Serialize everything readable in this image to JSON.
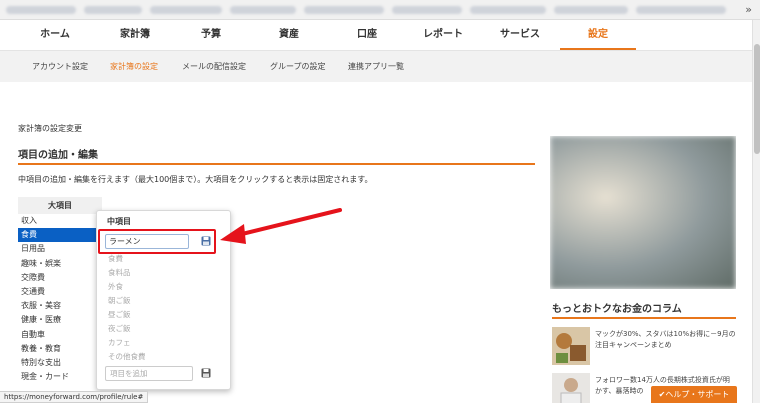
{
  "browser": {
    "more_label": "»",
    "status_url": "https://moneyforward.com/profile/rule#"
  },
  "main_nav": [
    "ホーム",
    "家計簿",
    "予算",
    "資産",
    "口座",
    "レポート",
    "サービス",
    "設定"
  ],
  "main_nav_active": "設定",
  "sub_nav": [
    "アカウント設定",
    "家計簿の設定",
    "メールの配信設定",
    "グループの設定",
    "連携アプリ一覧"
  ],
  "sub_nav_active": "家計簿の設定",
  "breadcrumb": "家計簿の設定変更",
  "section_title": "項目の追加・編集",
  "description": "中項目の追加・編集を行えます（最大100個まで）。大項目をクリックすると表示は固定されます。",
  "categories": {
    "header": "大項目",
    "items": [
      "収入",
      "食費",
      "日用品",
      "趣味・娯楽",
      "交際費",
      "交通費",
      "衣服・美容",
      "健康・医療",
      "自動車",
      "教養・教育",
      "特別な支出",
      "現金・カード"
    ],
    "selected": "食費"
  },
  "subcategory_popup": {
    "title": "中項目",
    "edit_value": "ラーメン",
    "items": [
      "食費",
      "食料品",
      "外食",
      "朝ご飯",
      "昼ご飯",
      "夜ご飯",
      "カフェ",
      "その他食費"
    ],
    "add_placeholder": "項目を追加",
    "save_icon": "floppy-disk-icon"
  },
  "sidebar": {
    "column_title": "もっとおトクなお金のコラム",
    "articles": [
      {
        "text": "マックが30%、スタバは10%お得に－9月の注目キャンペーンまとめ"
      },
      {
        "text": "フォロワー数14万人の長期株式投資氏が明かす、暴落時の"
      }
    ]
  },
  "help_button": "ヘルプ・サポート",
  "colors": {
    "accent": "#e8761b",
    "selected_blue": "#0a60c4",
    "highlight_red": "#e5131b"
  }
}
